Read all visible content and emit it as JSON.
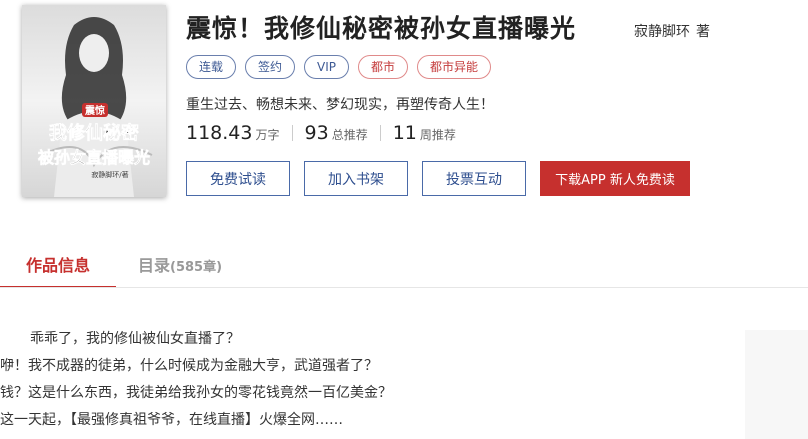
{
  "book": {
    "title": "震惊！我修仙秘密被孙女直播曝光",
    "author": "寂静脚环",
    "author_suffix": "著",
    "tags": [
      {
        "label": "连载",
        "style": "blue"
      },
      {
        "label": "签约",
        "style": "blue"
      },
      {
        "label": "VIP",
        "style": "blue"
      },
      {
        "label": "都市",
        "style": "red"
      },
      {
        "label": "都市异能",
        "style": "red"
      }
    ],
    "intro": "重生过去、畅想未来、梦幻现实，再塑传奇人生！",
    "stats": [
      {
        "value": "118.43",
        "unit": "万字"
      },
      {
        "value": "93",
        "unit": "总推荐"
      },
      {
        "value": "11",
        "unit": "周推荐"
      }
    ]
  },
  "cover": {
    "line1": "震惊",
    "line2": "我修仙秘密",
    "line3": "被孙女直播曝光",
    "author_caption": "寂静脚环/著"
  },
  "actions": {
    "free_read": "免费试读",
    "add_shelf": "加入书架",
    "vote": "投票互动",
    "download": "下载APP 新人免费读"
  },
  "tabs": {
    "info": "作品信息",
    "catalog": "目录",
    "catalog_count": "(585章)"
  },
  "description": [
    "乖乖了，我的修仙被仙女直播了？",
    "咿！我不成器的徒弟，什么时候成为金融大亨，武道强者了？",
    "钱？这是什么东西，我徒弟给我孙女的零花钱竟然一百亿美金？",
    "这一天起，【最强修真祖爷爷，在线直播】火爆全网……"
  ],
  "colors": {
    "accent": "#c6302e",
    "link_blue": "#2f4f8f",
    "tag_blue_border": "#6a7fad",
    "tag_red_border": "#e08a8a"
  }
}
